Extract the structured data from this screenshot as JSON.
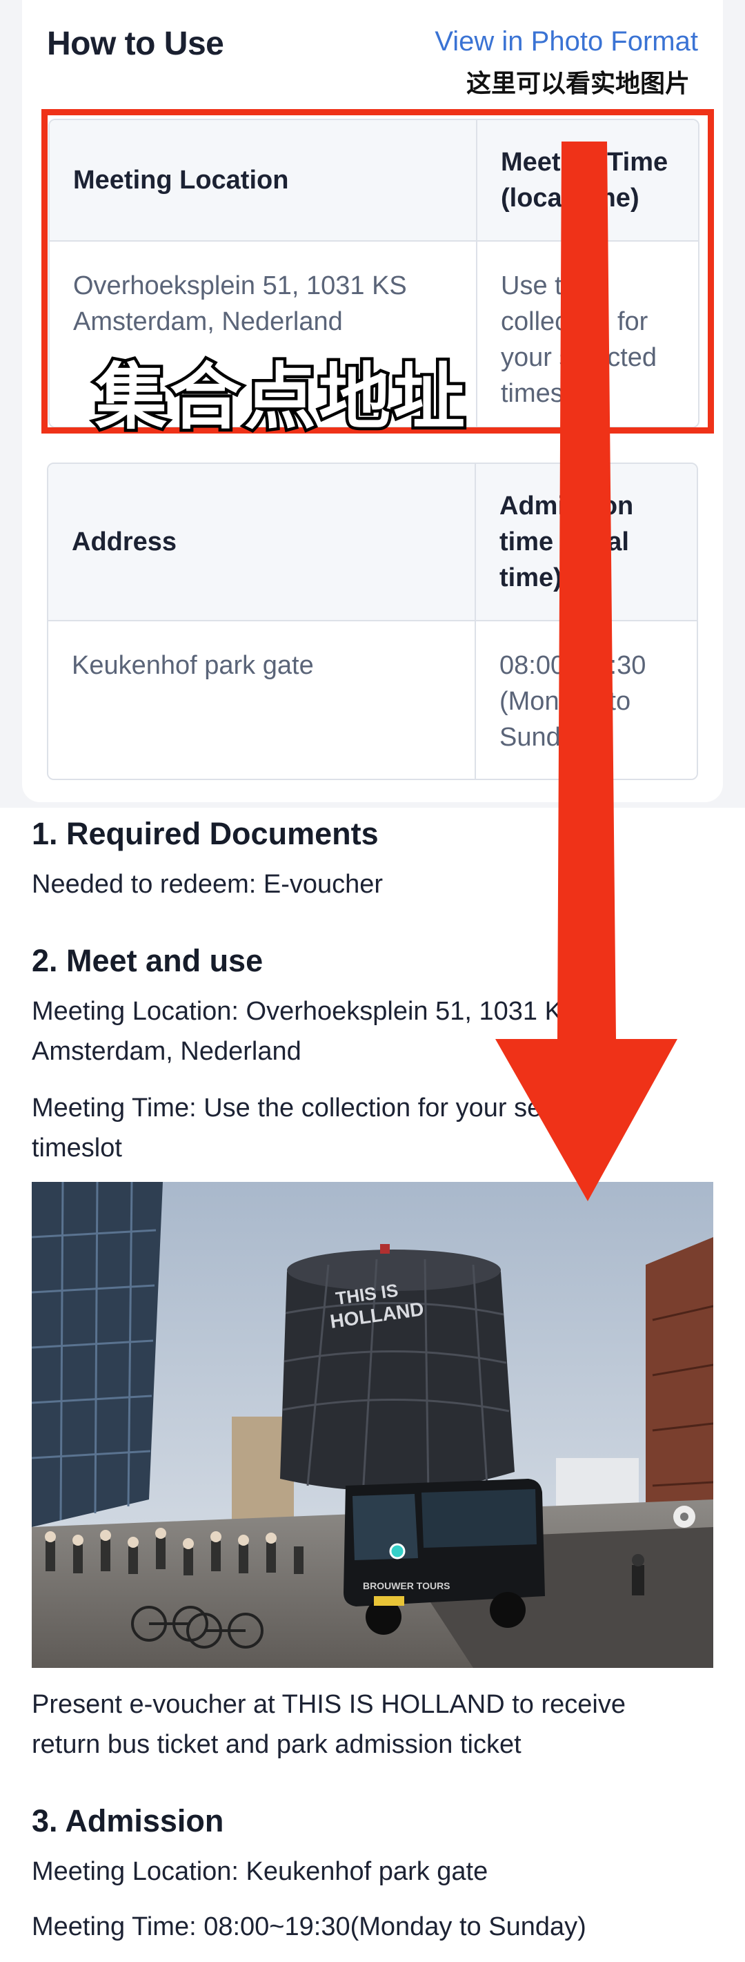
{
  "header": {
    "title": "How to Use",
    "photo_link": "View in Photo Format",
    "zh_note": "这里可以看实地图片"
  },
  "table1": {
    "headers": [
      "Meeting Location",
      "Meeting Time (local time)"
    ],
    "cells": [
      "Overhoeksplein 51, 1031 KS Amsterdam, Nederland",
      "Use the collection for your selected timeslot"
    ]
  },
  "table2": {
    "headers": [
      "Address",
      "Admission time (local time)"
    ],
    "cells": [
      "Keukenhof park gate",
      "08:00~19:30 (Monday to Sunday)"
    ]
  },
  "overlay": {
    "zh_label": "集合点地址",
    "highlight_color": "#ef3218"
  },
  "sections": {
    "s1": {
      "title": "1. Required Documents",
      "line1": "Needed to redeem: E-voucher"
    },
    "s2": {
      "title": "2. Meet and use",
      "location": "Meeting Location: Overhoeksplein 51, 1031 KS Amsterdam, Nederland",
      "time": "Meeting Time: Use the collection for your selected timeslot",
      "caption": "Present e-voucher at THIS IS HOLLAND to receive return bus ticket and park admission ticket"
    },
    "s3": {
      "title": "3. Admission",
      "location": "Meeting Location: Keukenhof park gate",
      "time": "Meeting Time: 08:00~19:30(Monday to Sunday)"
    }
  },
  "photo": {
    "building_sign": "THIS IS HOLLAND",
    "bus_label": "BROUWER TOURS"
  }
}
